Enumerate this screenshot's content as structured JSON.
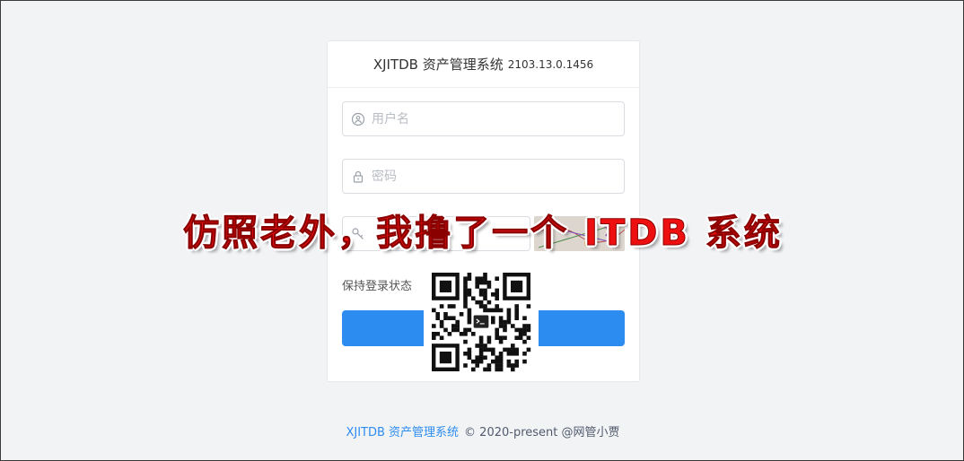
{
  "header": {
    "title": "XJITDB 资产管理系统",
    "version": "2103.13.0.1456"
  },
  "form": {
    "username_placeholder": "用户名",
    "password_placeholder": "密码",
    "captcha_placeholder": "",
    "remember_label": "保持登录状态",
    "login_label": ""
  },
  "overlay": {
    "banner_text": "仿照老外，我撸了一个 ITDB 系统"
  },
  "footer": {
    "brand": "XJITDB 资产管理系统",
    "copyright": "© 2020-present @网管小贾"
  },
  "colors": {
    "accent": "#2d8cf0",
    "banner": "#ee1010",
    "background": "#f2f3f5"
  },
  "icons": {
    "username": "user-icon",
    "password": "lock-icon",
    "captcha": "key-icon",
    "qr": "qr-code-icon",
    "qr_center": "terminal-icon"
  }
}
